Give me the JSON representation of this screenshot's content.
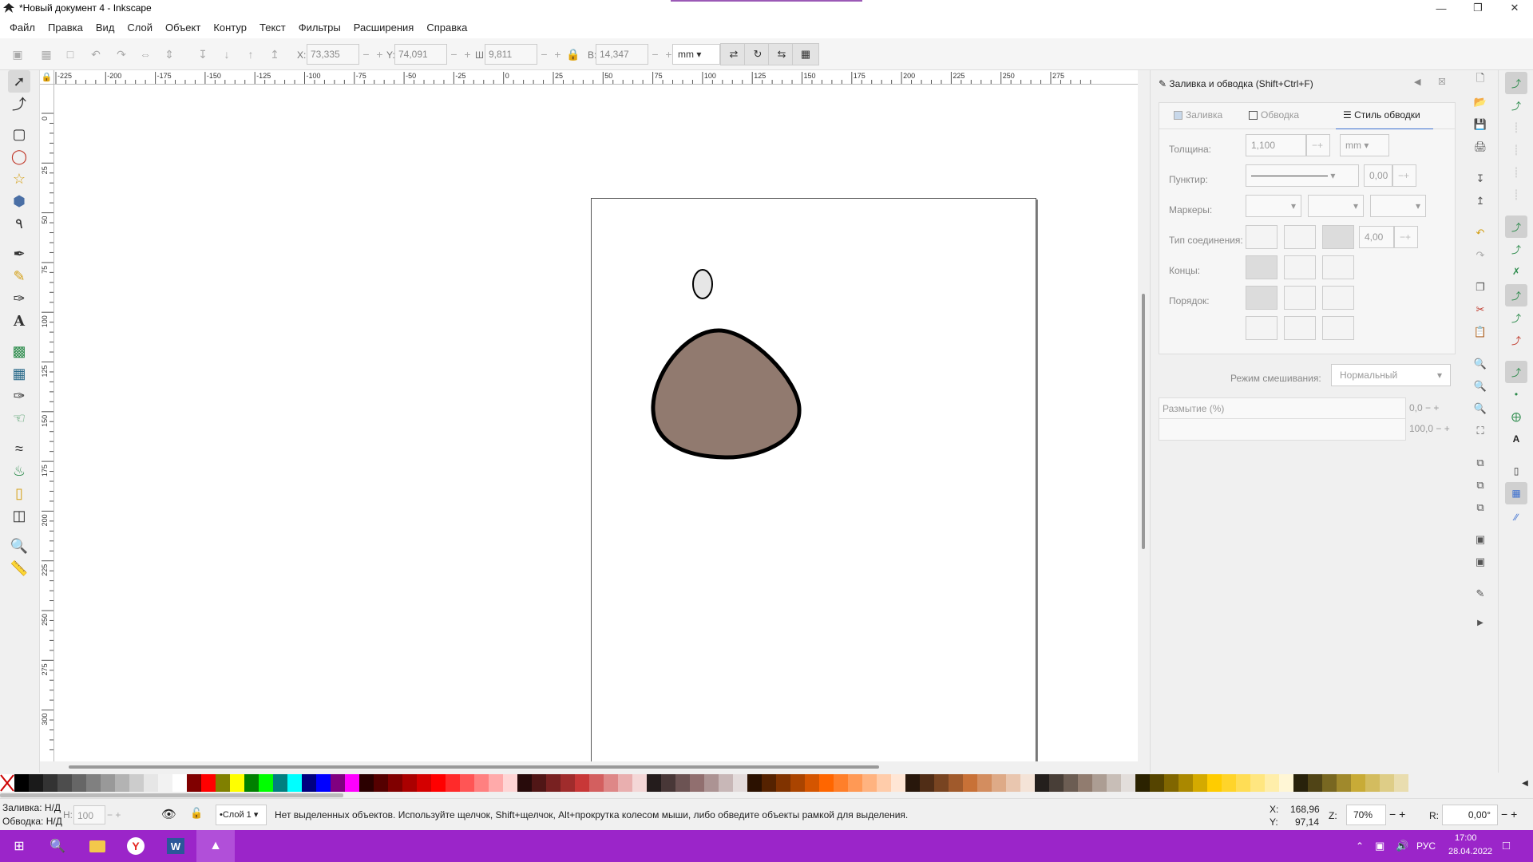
{
  "window": {
    "title": "*Новый документ 4 - Inkscape"
  },
  "menu": [
    "Файл",
    "Правка",
    "Вид",
    "Слой",
    "Объект",
    "Контур",
    "Текст",
    "Фильтры",
    "Расширения",
    "Справка"
  ],
  "toolbar": {
    "x_label": "X:",
    "x_value": "73,335",
    "y_label": "Y:",
    "y_value": "74,091",
    "w_label": "Ш:",
    "w_value": "9,811",
    "h_label": "В:",
    "h_value": "14,347",
    "unit": "mm"
  },
  "ruler_top_labels": [
    "-225",
    "-200",
    "-175",
    "-150",
    "-125",
    "-100",
    "-75",
    "-50",
    "-25",
    "0",
    "25",
    "50",
    "75",
    "100",
    "125",
    "150",
    "175",
    "200",
    "225",
    "250",
    "275"
  ],
  "ruler_left_labels": [
    "0",
    "25",
    "50",
    "75",
    "100",
    "125",
    "150",
    "175",
    "200",
    "225",
    "250",
    "275",
    "300"
  ],
  "canvas": {
    "shapes": {
      "small_ellipse": {
        "fill": "#e6e6e6",
        "stroke": "#000000"
      },
      "blob": {
        "fill": "#917a6f",
        "stroke": "#000000"
      }
    }
  },
  "dock": {
    "title": "Заливка и обводка (Shift+Ctrl+F)",
    "tabs": [
      "Заливка",
      "Обводка",
      "Стиль обводки"
    ],
    "active_tab": "Стиль обводки",
    "width_label": "Толщина:",
    "width_value": "1,100",
    "width_unit": "mm",
    "dash_label": "Пунктир:",
    "dash_value": "0,00",
    "markers_label": "Маркеры:",
    "join_label": "Тип соединения:",
    "join_value": "4,00",
    "caps_label": "Концы:",
    "order_label": "Порядок:",
    "blend_label": "Режим смешивания:",
    "blend_value": "Нормальный",
    "blur_label": "Размытие (%)",
    "blur_value": "0,0",
    "opacity_value": "100,0"
  },
  "palette_colors": [
    "#000000",
    "#1a1a1a",
    "#333333",
    "#4d4d4d",
    "#666666",
    "#808080",
    "#999999",
    "#b3b3b3",
    "#cccccc",
    "#e6e6e6",
    "#f2f2f2",
    "#ffffff",
    "#800000",
    "#ff0000",
    "#808000",
    "#ffff00",
    "#008000",
    "#00ff00",
    "#008080",
    "#00ffff",
    "#000080",
    "#0000ff",
    "#800080",
    "#ff00ff",
    "#2b0000",
    "#550000",
    "#800000",
    "#aa0000",
    "#d40000",
    "#ff0000",
    "#ff2a2a",
    "#ff5555",
    "#ff8080",
    "#ffaaaa",
    "#ffd5d5",
    "#280b0b",
    "#501616",
    "#782121",
    "#a02c2c",
    "#c83737",
    "#d35f5f",
    "#de8787",
    "#e9afaf",
    "#f4d7d7",
    "#241c1c",
    "#483737",
    "#6c5353",
    "#916f6f",
    "#ac9393",
    "#c8b7b7",
    "#e3dbdb",
    "#2b1100",
    "#552200",
    "#803300",
    "#aa4400",
    "#d45500",
    "#ff6600",
    "#ff7f2a",
    "#ff9955",
    "#ffb380",
    "#ffccaa",
    "#ffe6d5",
    "#28170b",
    "#502d16",
    "#784421",
    "#a05a2c",
    "#c87137",
    "#d38d5f",
    "#deaa87",
    "#e9c6af",
    "#f4e3d7",
    "#241f1c",
    "#483e37",
    "#6c5d53",
    "#917c6f",
    "#ac9d93",
    "#c8beb7",
    "#e3dedb",
    "#2b2200",
    "#554400",
    "#806600",
    "#aa8800",
    "#d4aa00",
    "#ffcc00",
    "#ffd42a",
    "#ffdd55",
    "#ffe680",
    "#ffeeaa",
    "#fff6d5",
    "#28220b",
    "#504416",
    "#786721",
    "#a0892c",
    "#c8ab37",
    "#d3bc5f",
    "#decd87",
    "#e9ddaf"
  ],
  "status": {
    "fill_label": "Заливка:",
    "fill_value": "Н/Д",
    "stroke_label": "Обводка:",
    "stroke_value": "Н/Д",
    "opacity_label": "Н:",
    "opacity_value": "100",
    "layer": "•Слой 1",
    "message": "Нет выделенных объектов. Используйте щелчок, Shift+щелчок, Alt+прокрутка колесом мыши, либо обведите объекты рамкой для выделения.",
    "x_label": "X:",
    "x_value": "168,96",
    "y_label": "Y:",
    "y_value": "97,14",
    "zoom_label": "Z:",
    "zoom_value": "70%",
    "rotate_label": "R:",
    "rotate_value": "0,00°"
  },
  "taskbar": {
    "lang": "РУС",
    "time": "17:00",
    "date": "28.04.2022",
    "accent": "#9b25c9"
  }
}
